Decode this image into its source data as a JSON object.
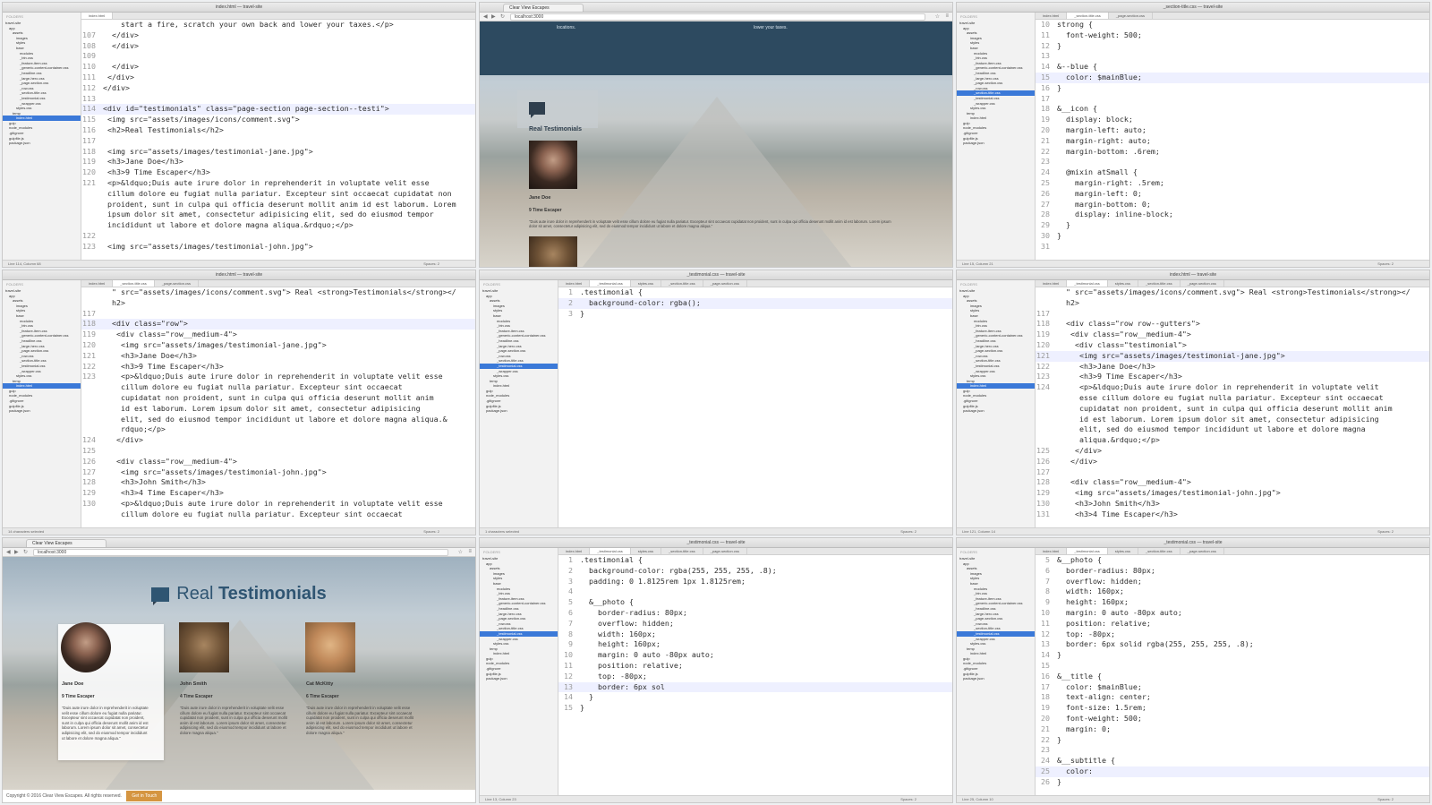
{
  "sidebar": {
    "header": "FOLDERS",
    "items": [
      "travel-site",
      "app",
      "assets",
      "images",
      "styles",
      "base",
      "modules",
      "_btn.css",
      "_feature-item.css",
      "_generic-content-container.css",
      "_headline.css",
      "_large-hero.css",
      "_page-section.css",
      "_row.css",
      "_section-title.css",
      "_testimonial.css",
      "_wrapper.css",
      "styles.css",
      "temp",
      "index.html",
      "gulp",
      "node_modules",
      ".gitignore",
      "gulpfile.js",
      "package.json"
    ]
  },
  "panels": [
    {
      "title": "index.html — travel-site",
      "tabs": [
        "index.html"
      ],
      "status_left": "Line 114, Column 68",
      "status_right": "Spaces: 2",
      "lines": [
        {
          "n": "",
          "t": "    start a fire, scratch your own back and lower your taxes.</p>"
        },
        {
          "n": "107",
          "t": "  </div>"
        },
        {
          "n": "108",
          "t": "  </div>"
        },
        {
          "n": "109",
          "t": ""
        },
        {
          "n": "110",
          "t": "  </div>"
        },
        {
          "n": "111",
          "t": " </div>"
        },
        {
          "n": "112",
          "t": "</div>"
        },
        {
          "n": "113",
          "t": ""
        },
        {
          "n": "114",
          "t": "<div id=\"testimonials\" class=\"page-section page-section--testi\">"
        },
        {
          "n": "115",
          "t": " <img src=\"assets/images/icons/comment.svg\">"
        },
        {
          "n": "116",
          "t": " <h2>Real Testimonials</h2>"
        },
        {
          "n": "117",
          "t": ""
        },
        {
          "n": "118",
          "t": " <img src=\"assets/images/testimonial-jane.jpg\">"
        },
        {
          "n": "119",
          "t": " <h3>Jane Doe</h3>"
        },
        {
          "n": "120",
          "t": " <h3>9 Time Escaper</h3>"
        },
        {
          "n": "121",
          "t": " <p>&ldquo;Duis aute irure dolor in reprehenderit in voluptate velit esse"
        },
        {
          "n": "",
          "t": " cillum dolore eu fugiat nulla pariatur. Excepteur sint occaecat cupidatat non"
        },
        {
          "n": "",
          "t": " proident, sunt in culpa qui officia deserunt mollit anim id est laborum. Lorem"
        },
        {
          "n": "",
          "t": " ipsum dolor sit amet, consectetur adipisicing elit, sed do eiusmod tempor"
        },
        {
          "n": "",
          "t": " incididunt ut labore et dolore magna aliqua.&rdquo;</p>"
        },
        {
          "n": "122",
          "t": ""
        },
        {
          "n": "123",
          "t": " <img src=\"assets/images/testimonial-john.jpg\">"
        }
      ]
    },
    {
      "title": "_section-title.css — travel-site",
      "tabs": [
        "index.html",
        "_section-title.css",
        "_page-section.css"
      ],
      "status_left": "Line 15, Column 21",
      "status_right": "Spaces: 2",
      "lines": [
        {
          "n": "10",
          "t": "strong {"
        },
        {
          "n": "11",
          "t": "  font-weight: 500;"
        },
        {
          "n": "12",
          "t": "}"
        },
        {
          "n": "13",
          "t": ""
        },
        {
          "n": "14",
          "t": "&--blue {"
        },
        {
          "n": "15",
          "t": "  color: $mainBlue;"
        },
        {
          "n": "16",
          "t": "}"
        },
        {
          "n": "17",
          "t": ""
        },
        {
          "n": "18",
          "t": "&__icon {"
        },
        {
          "n": "19",
          "t": "  display: block;"
        },
        {
          "n": "20",
          "t": "  margin-left: auto;"
        },
        {
          "n": "21",
          "t": "  margin-right: auto;"
        },
        {
          "n": "22",
          "t": "  margin-bottom: .6rem;"
        },
        {
          "n": "23",
          "t": ""
        },
        {
          "n": "24",
          "t": "  @mixin atSmall {"
        },
        {
          "n": "25",
          "t": "    margin-right: .5rem;"
        },
        {
          "n": "26",
          "t": "    margin-left: 0;"
        },
        {
          "n": "27",
          "t": "    margin-bottom: 0;"
        },
        {
          "n": "28",
          "t": "    display: inline-block;"
        },
        {
          "n": "29",
          "t": "  }"
        },
        {
          "n": "30",
          "t": "}"
        },
        {
          "n": "31",
          "t": ""
        }
      ]
    },
    {
      "title": "index.html — travel-site",
      "tabs": [
        "index.html",
        "_section-title.css",
        "_page-section.css"
      ],
      "status_left": "14 characters selected",
      "status_right": "Spaces: 2",
      "lines": [
        {
          "n": "",
          "t": "  \" src=\"assets/images/icons/comment.svg\"> Real <strong>Testimonials</strong></"
        },
        {
          "n": "",
          "t": "  h2>"
        },
        {
          "n": "117",
          "t": ""
        },
        {
          "n": "118",
          "t": "  <div class=\"row\">"
        },
        {
          "n": "119",
          "t": "   <div class=\"row__medium-4\">"
        },
        {
          "n": "120",
          "t": "    <img src=\"assets/images/testimonial-jane.jpg\">"
        },
        {
          "n": "121",
          "t": "    <h3>Jane Doe</h3>"
        },
        {
          "n": "122",
          "t": "    <h3>9 Time Escaper</h3>"
        },
        {
          "n": "123",
          "t": "    <p>&ldquo;Duis aute irure dolor in reprehenderit in voluptate velit esse"
        },
        {
          "n": "",
          "t": "    cillum dolore eu fugiat nulla pariatur. Excepteur sint occaecat"
        },
        {
          "n": "",
          "t": "    cupidatat non proident, sunt in culpa qui officia deserunt mollit anim"
        },
        {
          "n": "",
          "t": "    id est laborum. Lorem ipsum dolor sit amet, consectetur adipisicing"
        },
        {
          "n": "",
          "t": "    elit, sed do eiusmod tempor incididunt ut labore et dolore magna aliqua.&"
        },
        {
          "n": "",
          "t": "    rdquo;</p>"
        },
        {
          "n": "124",
          "t": "   </div>"
        },
        {
          "n": "125",
          "t": ""
        },
        {
          "n": "126",
          "t": "   <div class=\"row__medium-4\">"
        },
        {
          "n": "127",
          "t": "    <img src=\"assets/images/testimonial-john.jpg\">"
        },
        {
          "n": "128",
          "t": "    <h3>John Smith</h3>"
        },
        {
          "n": "129",
          "t": "    <h3>4 Time Escaper</h3>"
        },
        {
          "n": "130",
          "t": "    <p>&ldquo;Duis aute irure dolor in reprehenderit in voluptate velit esse"
        },
        {
          "n": "",
          "t": "    cillum dolore eu fugiat nulla pariatur. Excepteur sint occaecat"
        }
      ]
    },
    {
      "title": "_testimonial.css — travel-site",
      "tabs": [
        "index.html",
        "_testimonial.css",
        "styles.css",
        "_section-title.css",
        "_page-section.css"
      ],
      "status_left": "1 characters selected",
      "status_right": "Spaces: 2",
      "lines": [
        {
          "n": "1",
          "t": ".testimonial {"
        },
        {
          "n": "2",
          "t": "  background-color: rgba();"
        },
        {
          "n": "3",
          "t": "}"
        }
      ]
    },
    {
      "title": "index.html — travel-site",
      "tabs": [
        "index.html",
        "_testimonial.css",
        "styles.css",
        "_section-title.css",
        "_page-section.css"
      ],
      "status_left": "Line 121, Column 14",
      "status_right": "Spaces: 2",
      "lines": [
        {
          "n": "",
          "t": "  \" src=\"assets/images/icons/comment.svg\"> Real <strong>Testimonials</strong></"
        },
        {
          "n": "",
          "t": "  h2>"
        },
        {
          "n": "117",
          "t": ""
        },
        {
          "n": "118",
          "t": "  <div class=\"row row--gutters\">"
        },
        {
          "n": "119",
          "t": "   <div class=\"row__medium-4\">"
        },
        {
          "n": "120",
          "t": "    <div class=\"testimonial\">"
        },
        {
          "n": "121",
          "t": "     <img src=\"assets/images/testimonial-jane.jpg\">"
        },
        {
          "n": "122",
          "t": "     <h3>Jane Doe</h3>"
        },
        {
          "n": "123",
          "t": "     <h3>9 Time Escaper</h3>"
        },
        {
          "n": "124",
          "t": "     <p>&ldquo;Duis aute irure dolor in reprehenderit in voluptate velit"
        },
        {
          "n": "",
          "t": "     esse cillum dolore eu fugiat nulla pariatur. Excepteur sint occaecat"
        },
        {
          "n": "",
          "t": "     cupidatat non proident, sunt in culpa qui officia deserunt mollit anim"
        },
        {
          "n": "",
          "t": "     id est laborum. Lorem ipsum dolor sit amet, consectetur adipisicing"
        },
        {
          "n": "",
          "t": "     elit, sed do eiusmod tempor incididunt ut labore et dolore magna"
        },
        {
          "n": "",
          "t": "     aliqua.&rdquo;</p>"
        },
        {
          "n": "125",
          "t": "    </div>"
        },
        {
          "n": "126",
          "t": "   </div>"
        },
        {
          "n": "127",
          "t": ""
        },
        {
          "n": "128",
          "t": "   <div class=\"row__medium-4\">"
        },
        {
          "n": "129",
          "t": "    <img src=\"assets/images/testimonial-john.jpg\">"
        },
        {
          "n": "130",
          "t": "    <h3>John Smith</h3>"
        },
        {
          "n": "131",
          "t": "    <h3>4 Time Escaper</h3>"
        }
      ]
    },
    {
      "title": "_testimonial.css — travel-site",
      "tabs": [
        "index.html",
        "_testimonial.css",
        "styles.css",
        "_section-title.css",
        "_page-section.css"
      ],
      "status_left": "Line 13, Column 23",
      "status_right": "Spaces: 2",
      "lines": [
        {
          "n": "1",
          "t": ".testimonial {"
        },
        {
          "n": "2",
          "t": "  background-color: rgba(255, 255, 255, .8);"
        },
        {
          "n": "3",
          "t": "  padding: 0 1.8125rem 1px 1.8125rem;"
        },
        {
          "n": "4",
          "t": ""
        },
        {
          "n": "5",
          "t": "  &__photo {"
        },
        {
          "n": "6",
          "t": "    border-radius: 80px;"
        },
        {
          "n": "7",
          "t": "    overflow: hidden;"
        },
        {
          "n": "8",
          "t": "    width: 160px;"
        },
        {
          "n": "9",
          "t": "    height: 160px;"
        },
        {
          "n": "10",
          "t": "    margin: 0 auto -80px auto;"
        },
        {
          "n": "11",
          "t": "    position: relative;"
        },
        {
          "n": "12",
          "t": "    top: -80px;"
        },
        {
          "n": "13",
          "t": "    border: 6px sol"
        },
        {
          "n": "14",
          "t": "  }"
        },
        {
          "n": "15",
          "t": "}"
        }
      ]
    },
    {
      "title": "_testimonial.css — travel-site",
      "tabs": [
        "index.html",
        "_testimonial.css",
        "styles.css",
        "_section-title.css",
        "_page-section.css"
      ],
      "status_left": "Line 25, Column 10",
      "status_right": "Spaces: 2",
      "lines": [
        {
          "n": "5",
          "t": "&__photo {"
        },
        {
          "n": "6",
          "t": "  border-radius: 80px;"
        },
        {
          "n": "7",
          "t": "  overflow: hidden;"
        },
        {
          "n": "8",
          "t": "  width: 160px;"
        },
        {
          "n": "9",
          "t": "  height: 160px;"
        },
        {
          "n": "10",
          "t": "  margin: 0 auto -80px auto;"
        },
        {
          "n": "11",
          "t": "  position: relative;"
        },
        {
          "n": "12",
          "t": "  top: -80px;"
        },
        {
          "n": "13",
          "t": "  border: 6px solid rgba(255, 255, 255, .8);"
        },
        {
          "n": "14",
          "t": "}"
        },
        {
          "n": "15",
          "t": ""
        },
        {
          "n": "16",
          "t": "&__title {"
        },
        {
          "n": "17",
          "t": "  color: $mainBlue;"
        },
        {
          "n": "18",
          "t": "  text-align: center;"
        },
        {
          "n": "19",
          "t": "  font-size: 1.5rem;"
        },
        {
          "n": "20",
          "t": "  font-weight: 500;"
        },
        {
          "n": "21",
          "t": "  margin: 0;"
        },
        {
          "n": "22",
          "t": "}"
        },
        {
          "n": "23",
          "t": ""
        },
        {
          "n": "24",
          "t": "&__subtitle {"
        },
        {
          "n": "25",
          "t": "  color: "
        },
        {
          "n": "26",
          "t": "}"
        }
      ]
    }
  ],
  "browser_top": {
    "tab": "Clear View Escapes",
    "url": "localhost:3000",
    "top_text_left": "locations.",
    "top_text_right": "lower your taxes.",
    "heading": "Real Testimonials",
    "name": "Jane Doe",
    "subtitle": "9 Time Escaper",
    "quote": "\"Duis aute irure dolor in reprehenderit in voluptate velit esse cillum dolore eu fugiat nulla pariatur. Excepteur sint occaecat cupidatat non proident, sunt in culpa qui officia deserunt mollit anim id est laborum. Lorem ipsum dolor sit amet, consectetur adipisicing elit, sed do eiusmod tempor incididunt ut labore et dolore magna aliqua.\""
  },
  "browser_bottom": {
    "tab": "Clear View Escapes",
    "url": "localhost:3000",
    "heading_light": "Real",
    "heading_bold": "Testimonials",
    "testimonials": [
      {
        "name": "Jane Doe",
        "subtitle": "9 Time Escaper",
        "quote": "\"Duis aute irure dolor in reprehenderit in voluptate velit esse cillum dolore eu fugiat nulla pariatur. Excepteur sint occaecat cupidatat non proident, sunt in culpa qui officia deserunt mollit anim id est laborum. Lorem ipsum dolor sit amet, consectetur adipisicing elit, sed do eiusmod tempor incididunt ut labore et dolore magna aliqua.\""
      },
      {
        "name": "John Smith",
        "subtitle": "4 Time Escaper",
        "quote": "\"Duis aute irure dolor in reprehenderit in voluptate velit esse cillum dolore eu fugiat nulla pariatur. Excepteur sint occaecat cupidatat non proident, sunt in culpa qui officia deserunt mollit anim id est laborum. Lorem ipsum dolor sit amet, consectetur adipisicing elit, sed do eiusmod tempor incididunt ut labore et dolore magna aliqua.\""
      },
      {
        "name": "Cat McKitty",
        "subtitle": "6 Time Escaper",
        "quote": "\"Duis aute irure dolor in reprehenderit in voluptate velit esse cillum dolore eu fugiat nulla pariatur. Excepteur sint occaecat cupidatat non proident, sunt in culpa qui officia deserunt mollit anim id est laborum. Lorem ipsum dolor sit amet, consectetur adipisicing elit, sed do eiusmod tempor incididunt ut labore et dolore magna aliqua.\""
      }
    ],
    "footer_text": "Copyright © 2016 Clear View Escapes. All rights reserved.",
    "footer_button": "Get in Touch"
  },
  "colors": {
    "main_blue": "#2f5572",
    "accent_orange": "#d59541",
    "selection": "#3b79d8"
  }
}
